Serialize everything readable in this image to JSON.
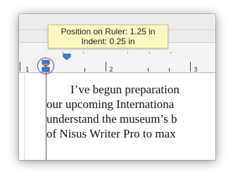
{
  "tooltip": {
    "position_line": "Position on Ruler: 1.25 in",
    "indent_line": "Indent: 0.25 in"
  },
  "ruler": {
    "numbers": [
      "1",
      "2",
      "3"
    ],
    "tab_stop_color": "#3b7fd6",
    "indent_marker_color": "#3b7fd6",
    "highlight_circle_color": "#9b3a8f"
  },
  "document": {
    "lines": [
      "I’ve begun preparation",
      "our upcoming Internationa",
      "understand the museum’s b",
      "of Nisus Writer Pro to max"
    ]
  },
  "icons": {
    "tab_stop": "tab-stop-icon",
    "indent_marker": "indent-marker-icon"
  }
}
